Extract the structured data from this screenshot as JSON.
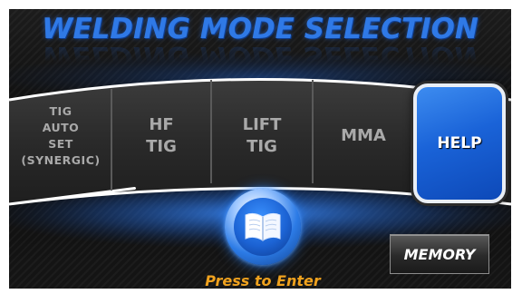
{
  "title": "WELDING MODE SELECTION",
  "modes": [
    {
      "lines": [
        "TIG",
        "AUTO",
        "SET",
        "(SYNERGIC)"
      ]
    },
    {
      "lines": [
        "HF",
        "TIG"
      ]
    },
    {
      "lines": [
        "LIFT",
        "TIG"
      ]
    },
    {
      "lines": [
        "MMA"
      ]
    }
  ],
  "help": {
    "label": "HELP"
  },
  "manual": {
    "icon": "book-icon",
    "caption": "Press to Enter"
  },
  "memory": {
    "label": "MEMORY"
  },
  "colors": {
    "title": "#2f79e6",
    "mode_text": "#a9a9a9",
    "help_button": "#1a63d8",
    "press_text": "#f0a21e",
    "arc_edge": "#ffffff",
    "glow": "#2c7be6"
  }
}
